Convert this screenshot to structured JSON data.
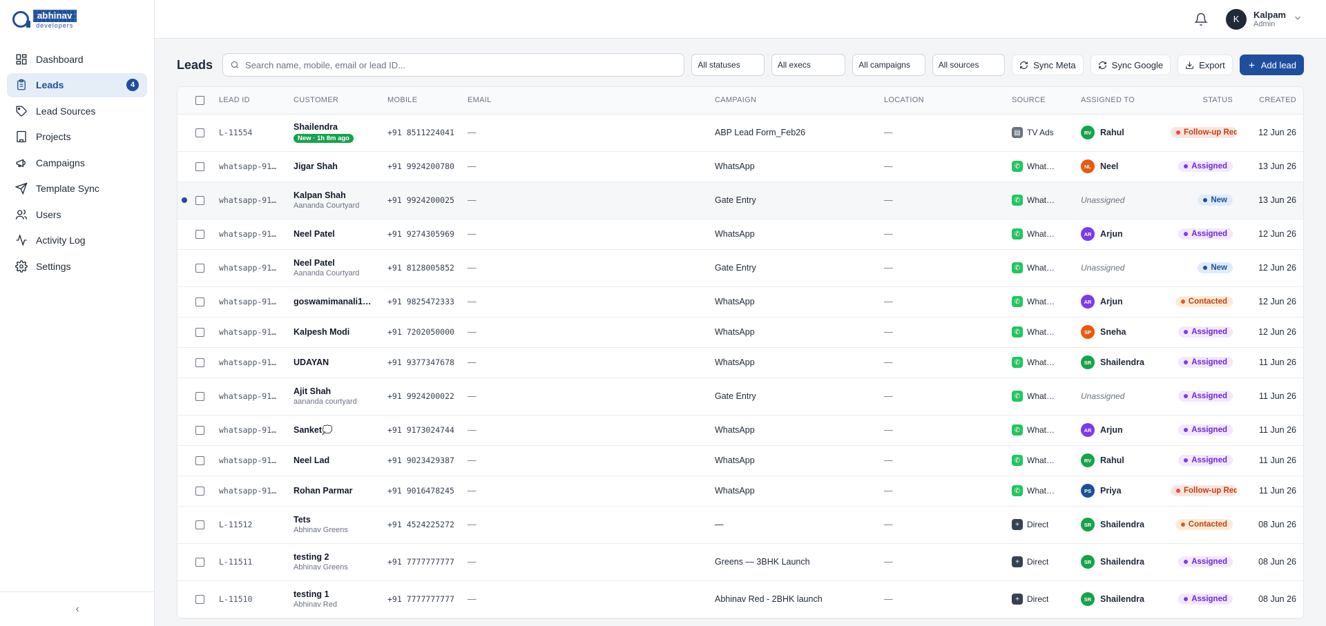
{
  "brand": {
    "name": "abhinav",
    "sub": "developers",
    "color": "#1e4e9c"
  },
  "nav": [
    {
      "label": "Dashboard",
      "icon": "dashboard-icon",
      "active": false
    },
    {
      "label": "Leads",
      "icon": "clipboard-icon",
      "active": true,
      "badge": "4"
    },
    {
      "label": "Lead Sources",
      "icon": "tag-icon",
      "active": false
    },
    {
      "label": "Projects",
      "icon": "building-icon",
      "active": false
    },
    {
      "label": "Campaigns",
      "icon": "megaphone-icon",
      "active": false
    },
    {
      "label": "Template Sync",
      "icon": "send-icon",
      "active": false
    },
    {
      "label": "Users",
      "icon": "users-icon",
      "active": false
    },
    {
      "label": "Activity Log",
      "icon": "activity-icon",
      "active": false
    },
    {
      "label": "Settings",
      "icon": "gear-icon",
      "active": false
    }
  ],
  "collapse_glyph": "‹",
  "user": {
    "initial": "K",
    "name": "Kalpam",
    "role": "Admin"
  },
  "page": {
    "title": "Leads",
    "search_placeholder": "Search name, mobile, email or lead ID...",
    "filters": [
      "All statuses",
      "All execs",
      "All campaigns",
      "All sources"
    ],
    "actions": {
      "sync_meta": "Sync Meta",
      "sync_google": "Sync Google",
      "export": "Export",
      "add_lead": "Add lead"
    }
  },
  "table": {
    "columns": [
      "LEAD ID",
      "CUSTOMER",
      "MOBILE",
      "EMAIL",
      "CAMPAIGN",
      "LOCATION",
      "SOURCE",
      "ASSIGNED TO",
      "STATUS",
      "CREATED"
    ],
    "rows": [
      {
        "id": "L-11554",
        "name": "Shailendra",
        "pill": "New · 1h 8m ago",
        "mobile": "+91 8511224041",
        "email": "—",
        "campaign": "ABP Lead Form_Feb26",
        "location": "—",
        "source": "TV Ads",
        "source_type": "tv",
        "assignee": {
          "initials": "RV",
          "name": "Rahul",
          "color": "#16a34a"
        },
        "status": "Follow-up Req",
        "status_type": "followup",
        "created": "12 Jun 26"
      },
      {
        "id": "whatsapp-91…",
        "name": "Jigar Shah",
        "mobile": "+91 9924200780",
        "email": "—",
        "campaign": "WhatsApp",
        "location": "—",
        "source": "WhatsA…",
        "source_type": "wa",
        "assignee": {
          "initials": "NL",
          "name": "Neel",
          "color": "#ea580c"
        },
        "status": "Assigned",
        "status_type": "assigned",
        "created": "13 Jun 26"
      },
      {
        "id": "whatsapp-91…",
        "name": "Kalpan Shah",
        "sub": "Aananda Courtyard",
        "mobile": "+91 9924200025",
        "email": "—",
        "campaign": "Gate Entry",
        "location": "—",
        "source": "WhatsA…",
        "source_type": "wa",
        "assignee": null,
        "unassigned": "Unassigned",
        "status": "New",
        "status_type": "new",
        "created": "13 Jun 26",
        "selected": true
      },
      {
        "id": "whatsapp-91…",
        "name": "Neel Patel",
        "mobile": "+91 9274305969",
        "email": "—",
        "campaign": "WhatsApp",
        "location": "—",
        "source": "WhatsA…",
        "source_type": "wa",
        "assignee": {
          "initials": "AR",
          "name": "Arjun",
          "color": "#7c3aed"
        },
        "status": "Assigned",
        "status_type": "assigned",
        "created": "12 Jun 26"
      },
      {
        "id": "whatsapp-91…",
        "name": "Neel Patel",
        "sub": "Aananda Courtyard",
        "mobile": "+91 8128005852",
        "email": "—",
        "campaign": "Gate Entry",
        "location": "—",
        "source": "WhatsA…",
        "source_type": "wa",
        "assignee": null,
        "unassigned": "Unassigned",
        "status": "New",
        "status_type": "new",
        "created": "12 Jun 26"
      },
      {
        "id": "whatsapp-91…",
        "name": "goswamimanali1…",
        "mobile": "+91 9825472333",
        "email": "—",
        "campaign": "WhatsApp",
        "location": "—",
        "source": "WhatsA…",
        "source_type": "wa",
        "assignee": {
          "initials": "AR",
          "name": "Arjun",
          "color": "#7c3aed"
        },
        "status": "Contacted",
        "status_type": "contacted",
        "created": "12 Jun 26"
      },
      {
        "id": "whatsapp-91…",
        "name": "Kalpesh Modi",
        "mobile": "+91 7202050000",
        "email": "—",
        "campaign": "WhatsApp",
        "location": "—",
        "source": "WhatsA…",
        "source_type": "wa",
        "assignee": {
          "initials": "SP",
          "name": "Sneha",
          "color": "#ea580c"
        },
        "status": "Assigned",
        "status_type": "assigned",
        "created": "12 Jun 26"
      },
      {
        "id": "whatsapp-91…",
        "name": "UDAYAN",
        "mobile": "+91 9377347678",
        "email": "—",
        "campaign": "WhatsApp",
        "location": "—",
        "source": "WhatsA…",
        "source_type": "wa",
        "assignee": {
          "initials": "SR",
          "name": "Shailendra",
          "color": "#16a34a"
        },
        "status": "Assigned",
        "status_type": "assigned",
        "created": "11 Jun 26"
      },
      {
        "id": "whatsapp-91…",
        "name": "Ajit Shah",
        "sub": "aananda courtyard",
        "mobile": "+91 9924200022",
        "email": "—",
        "campaign": "Gate Entry",
        "location": "—",
        "source": "WhatsA…",
        "source_type": "wa",
        "assignee": null,
        "unassigned": "Unassigned",
        "status": "Assigned",
        "status_type": "assigned",
        "created": "11 Jun 26"
      },
      {
        "id": "whatsapp-91…",
        "name": "Sanket💭",
        "mobile": "+91 9173024744",
        "email": "—",
        "campaign": "WhatsApp",
        "location": "—",
        "source": "WhatsA…",
        "source_type": "wa",
        "assignee": {
          "initials": "AR",
          "name": "Arjun",
          "color": "#7c3aed"
        },
        "status": "Assigned",
        "status_type": "assigned",
        "created": "11 Jun 26"
      },
      {
        "id": "whatsapp-91…",
        "name": "Neel Lad",
        "mobile": "+91 9023429387",
        "email": "—",
        "campaign": "WhatsApp",
        "location": "—",
        "source": "WhatsA…",
        "source_type": "wa",
        "assignee": {
          "initials": "RV",
          "name": "Rahul",
          "color": "#16a34a"
        },
        "status": "Assigned",
        "status_type": "assigned",
        "created": "11 Jun 26"
      },
      {
        "id": "whatsapp-91…",
        "name": "Rohan Parmar",
        "mobile": "+91 9016478245",
        "email": "—",
        "campaign": "WhatsApp",
        "location": "—",
        "source": "WhatsA…",
        "source_type": "wa",
        "assignee": {
          "initials": "PS",
          "name": "Priya",
          "color": "#1e4e9c"
        },
        "status": "Follow-up Req",
        "status_type": "followup",
        "created": "11 Jun 26"
      },
      {
        "id": "L-11512",
        "name": "Tets",
        "sub": "Abhinav Greens",
        "mobile": "+91 4524225272",
        "email": "—",
        "campaign": "—",
        "location": "—",
        "source": "Direct",
        "source_type": "direct",
        "assignee": {
          "initials": "SR",
          "name": "Shailendra",
          "color": "#16a34a"
        },
        "status": "Contacted",
        "status_type": "contacted",
        "created": "08 Jun 26"
      },
      {
        "id": "L-11511",
        "name": "testing 2",
        "sub": "Abhinav Greens",
        "mobile": "+91 7777777777",
        "email": "—",
        "campaign": "Greens — 3BHK Launch",
        "location": "—",
        "source": "Direct",
        "source_type": "direct",
        "assignee": {
          "initials": "SR",
          "name": "Shailendra",
          "color": "#16a34a"
        },
        "status": "Assigned",
        "status_type": "assigned",
        "created": "08 Jun 26"
      },
      {
        "id": "L-11510",
        "name": "testing 1",
        "sub": "Abhinav Red",
        "mobile": "+91 7777777777",
        "email": "—",
        "campaign": "Abhinav Red - 2BHK launch",
        "location": "—",
        "source": "Direct",
        "source_type": "direct",
        "assignee": {
          "initials": "SR",
          "name": "Shailendra",
          "color": "#16a34a"
        },
        "status": "Assigned",
        "status_type": "assigned",
        "created": "08 Jun 26"
      }
    ]
  },
  "status_colors": {
    "assigned": {
      "bg": "#f3e8ff",
      "fg": "#6d28d9",
      "dot": "#7c3aed"
    },
    "new": {
      "bg": "#e0ecfb",
      "fg": "#1e4e9c",
      "dot": "#1e4e9c"
    },
    "contacted": {
      "bg": "#fdebd8",
      "fg": "#c2410c",
      "dot": "#ea580c"
    },
    "followup": {
      "bg": "#fde4e1",
      "fg": "#c2410c",
      "dot": "#ef4444"
    }
  }
}
